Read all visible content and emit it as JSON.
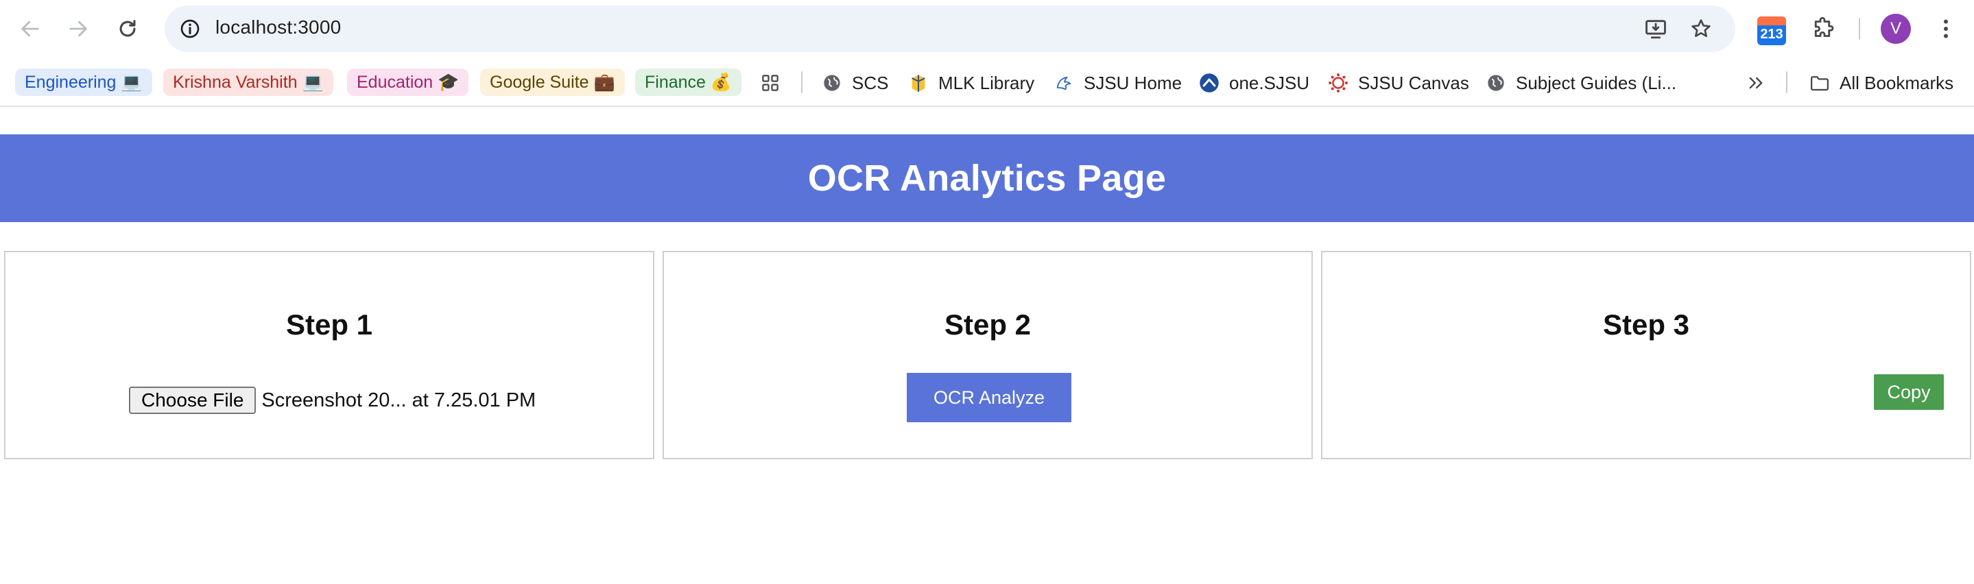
{
  "browser": {
    "url": "localhost:3000",
    "calendar_badge": "213",
    "profile_initial": "V"
  },
  "bookmarks": {
    "groups": [
      {
        "label": "Engineering 💻",
        "bg": "#e3ecfb",
        "color": "#1a56c6"
      },
      {
        "label": "Krishna Varshith 💻",
        "bg": "#fbe4e2",
        "color": "#b3261e"
      },
      {
        "label": "Education 🎓",
        "bg": "#fbe2f0",
        "color": "#a3226d"
      },
      {
        "label": "Google Suite 💼",
        "bg": "#fcf1d9",
        "color": "#5d4300"
      },
      {
        "label": "Finance 💰",
        "bg": "#e2f2e4",
        "color": "#1e6b2e"
      }
    ],
    "links": [
      "SCS",
      "MLK Library",
      "SJSU Home",
      "one.SJSU",
      "SJSU Canvas",
      "Subject Guides (Li..."
    ],
    "all_bookmarks": "All Bookmarks"
  },
  "page": {
    "title": "OCR Analytics Page",
    "step1": {
      "title": "Step 1",
      "choose_file_label": "Choose File",
      "file_name": "Screenshot 20... at 7.25.01 PM"
    },
    "step2": {
      "title": "Step 2",
      "analyze_label": "OCR Analyze"
    },
    "step3": {
      "title": "Step 3",
      "copy_label": "Copy"
    }
  },
  "colors": {
    "banner": "#5a73d9",
    "analyze_button": "#5a73d9",
    "copy_button": "#4a9d4f"
  }
}
